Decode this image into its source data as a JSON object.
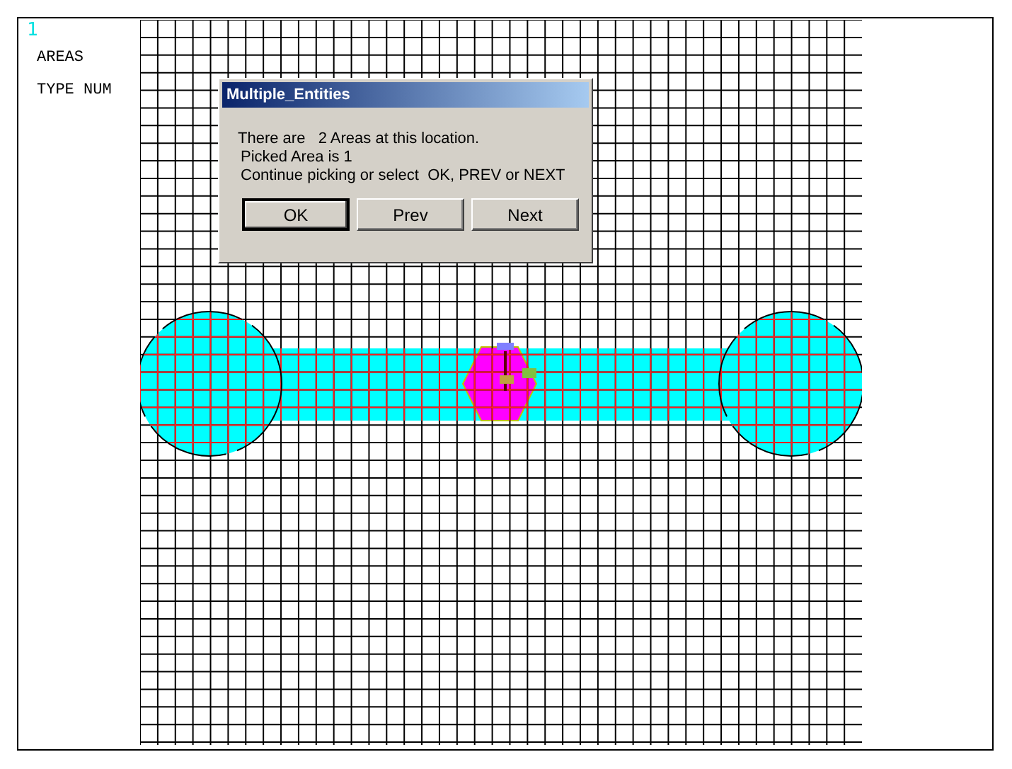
{
  "viewport_number": "1",
  "legend": [
    "AREAS",
    "TYPE NUM"
  ],
  "dialog": {
    "title": "Multiple_Entities",
    "lines": [
      "There are   2 Areas at this location.",
      "Picked Area is 1",
      "Continue picking or select  OK, PREV or NEXT"
    ],
    "buttons": [
      {
        "label": "OK",
        "default": true
      },
      {
        "label": "Prev",
        "default": false
      },
      {
        "label": "Next",
        "default": false
      }
    ]
  }
}
